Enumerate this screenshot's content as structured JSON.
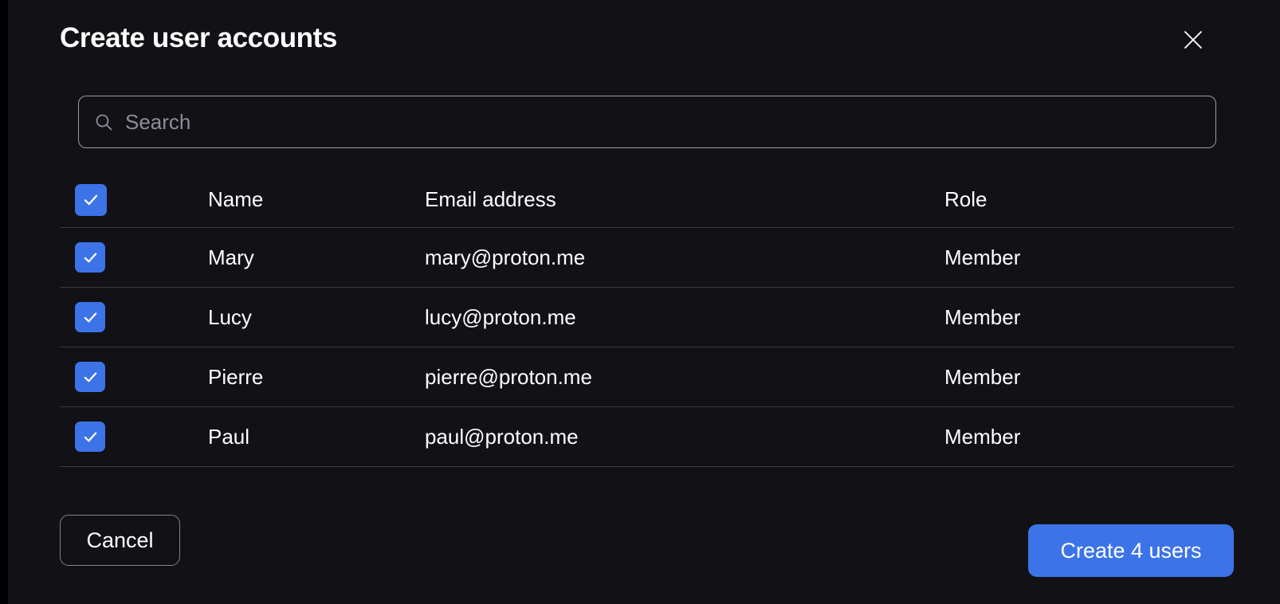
{
  "colors": {
    "accent": "#3c74e8",
    "background": "#111116",
    "page_background": "#000000",
    "separator": "#3a3a44",
    "placeholder_text": "#8d8d98",
    "text": "#ffffff"
  },
  "dialog": {
    "title": "Create user accounts",
    "close_icon": "close-icon",
    "close_label": "Close"
  },
  "search": {
    "icon": "search-icon",
    "placeholder": "Search",
    "value": ""
  },
  "table": {
    "select_all_checked": true,
    "columns": {
      "checkbox": "",
      "name": "Name",
      "email": "Email address",
      "role": "Role"
    },
    "rows": [
      {
        "checked": true,
        "name": "Mary",
        "email": "mary@proton.me",
        "role": "Member"
      },
      {
        "checked": true,
        "name": "Lucy",
        "email": "lucy@proton.me",
        "role": "Member"
      },
      {
        "checked": true,
        "name": "Pierre",
        "email": "pierre@proton.me",
        "role": "Member"
      },
      {
        "checked": true,
        "name": "Paul",
        "email": "paul@proton.me",
        "role": "Member"
      }
    ]
  },
  "footer": {
    "cancel_label": "Cancel",
    "create_label": "Create 4 users",
    "selected_count": 4
  }
}
